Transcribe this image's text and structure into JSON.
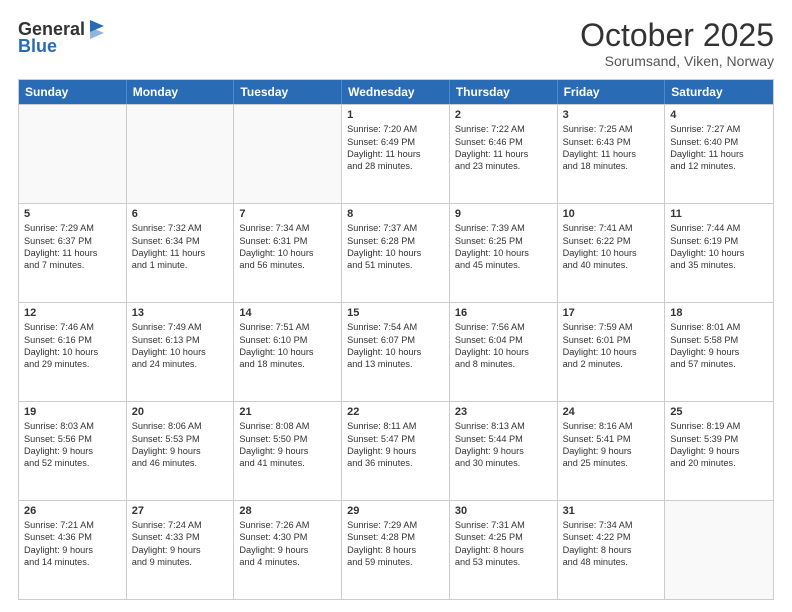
{
  "header": {
    "logo_line1": "General",
    "logo_line2": "Blue",
    "month": "October 2025",
    "location": "Sorumsand, Viken, Norway"
  },
  "weekdays": [
    "Sunday",
    "Monday",
    "Tuesday",
    "Wednesday",
    "Thursday",
    "Friday",
    "Saturday"
  ],
  "rows": [
    [
      {
        "day": "",
        "lines": []
      },
      {
        "day": "",
        "lines": []
      },
      {
        "day": "",
        "lines": []
      },
      {
        "day": "1",
        "lines": [
          "Sunrise: 7:20 AM",
          "Sunset: 6:49 PM",
          "Daylight: 11 hours",
          "and 28 minutes."
        ]
      },
      {
        "day": "2",
        "lines": [
          "Sunrise: 7:22 AM",
          "Sunset: 6:46 PM",
          "Daylight: 11 hours",
          "and 23 minutes."
        ]
      },
      {
        "day": "3",
        "lines": [
          "Sunrise: 7:25 AM",
          "Sunset: 6:43 PM",
          "Daylight: 11 hours",
          "and 18 minutes."
        ]
      },
      {
        "day": "4",
        "lines": [
          "Sunrise: 7:27 AM",
          "Sunset: 6:40 PM",
          "Daylight: 11 hours",
          "and 12 minutes."
        ]
      }
    ],
    [
      {
        "day": "5",
        "lines": [
          "Sunrise: 7:29 AM",
          "Sunset: 6:37 PM",
          "Daylight: 11 hours",
          "and 7 minutes."
        ]
      },
      {
        "day": "6",
        "lines": [
          "Sunrise: 7:32 AM",
          "Sunset: 6:34 PM",
          "Daylight: 11 hours",
          "and 1 minute."
        ]
      },
      {
        "day": "7",
        "lines": [
          "Sunrise: 7:34 AM",
          "Sunset: 6:31 PM",
          "Daylight: 10 hours",
          "and 56 minutes."
        ]
      },
      {
        "day": "8",
        "lines": [
          "Sunrise: 7:37 AM",
          "Sunset: 6:28 PM",
          "Daylight: 10 hours",
          "and 51 minutes."
        ]
      },
      {
        "day": "9",
        "lines": [
          "Sunrise: 7:39 AM",
          "Sunset: 6:25 PM",
          "Daylight: 10 hours",
          "and 45 minutes."
        ]
      },
      {
        "day": "10",
        "lines": [
          "Sunrise: 7:41 AM",
          "Sunset: 6:22 PM",
          "Daylight: 10 hours",
          "and 40 minutes."
        ]
      },
      {
        "day": "11",
        "lines": [
          "Sunrise: 7:44 AM",
          "Sunset: 6:19 PM",
          "Daylight: 10 hours",
          "and 35 minutes."
        ]
      }
    ],
    [
      {
        "day": "12",
        "lines": [
          "Sunrise: 7:46 AM",
          "Sunset: 6:16 PM",
          "Daylight: 10 hours",
          "and 29 minutes."
        ]
      },
      {
        "day": "13",
        "lines": [
          "Sunrise: 7:49 AM",
          "Sunset: 6:13 PM",
          "Daylight: 10 hours",
          "and 24 minutes."
        ]
      },
      {
        "day": "14",
        "lines": [
          "Sunrise: 7:51 AM",
          "Sunset: 6:10 PM",
          "Daylight: 10 hours",
          "and 18 minutes."
        ]
      },
      {
        "day": "15",
        "lines": [
          "Sunrise: 7:54 AM",
          "Sunset: 6:07 PM",
          "Daylight: 10 hours",
          "and 13 minutes."
        ]
      },
      {
        "day": "16",
        "lines": [
          "Sunrise: 7:56 AM",
          "Sunset: 6:04 PM",
          "Daylight: 10 hours",
          "and 8 minutes."
        ]
      },
      {
        "day": "17",
        "lines": [
          "Sunrise: 7:59 AM",
          "Sunset: 6:01 PM",
          "Daylight: 10 hours",
          "and 2 minutes."
        ]
      },
      {
        "day": "18",
        "lines": [
          "Sunrise: 8:01 AM",
          "Sunset: 5:58 PM",
          "Daylight: 9 hours",
          "and 57 minutes."
        ]
      }
    ],
    [
      {
        "day": "19",
        "lines": [
          "Sunrise: 8:03 AM",
          "Sunset: 5:56 PM",
          "Daylight: 9 hours",
          "and 52 minutes."
        ]
      },
      {
        "day": "20",
        "lines": [
          "Sunrise: 8:06 AM",
          "Sunset: 5:53 PM",
          "Daylight: 9 hours",
          "and 46 minutes."
        ]
      },
      {
        "day": "21",
        "lines": [
          "Sunrise: 8:08 AM",
          "Sunset: 5:50 PM",
          "Daylight: 9 hours",
          "and 41 minutes."
        ]
      },
      {
        "day": "22",
        "lines": [
          "Sunrise: 8:11 AM",
          "Sunset: 5:47 PM",
          "Daylight: 9 hours",
          "and 36 minutes."
        ]
      },
      {
        "day": "23",
        "lines": [
          "Sunrise: 8:13 AM",
          "Sunset: 5:44 PM",
          "Daylight: 9 hours",
          "and 30 minutes."
        ]
      },
      {
        "day": "24",
        "lines": [
          "Sunrise: 8:16 AM",
          "Sunset: 5:41 PM",
          "Daylight: 9 hours",
          "and 25 minutes."
        ]
      },
      {
        "day": "25",
        "lines": [
          "Sunrise: 8:19 AM",
          "Sunset: 5:39 PM",
          "Daylight: 9 hours",
          "and 20 minutes."
        ]
      }
    ],
    [
      {
        "day": "26",
        "lines": [
          "Sunrise: 7:21 AM",
          "Sunset: 4:36 PM",
          "Daylight: 9 hours",
          "and 14 minutes."
        ]
      },
      {
        "day": "27",
        "lines": [
          "Sunrise: 7:24 AM",
          "Sunset: 4:33 PM",
          "Daylight: 9 hours",
          "and 9 minutes."
        ]
      },
      {
        "day": "28",
        "lines": [
          "Sunrise: 7:26 AM",
          "Sunset: 4:30 PM",
          "Daylight: 9 hours",
          "and 4 minutes."
        ]
      },
      {
        "day": "29",
        "lines": [
          "Sunrise: 7:29 AM",
          "Sunset: 4:28 PM",
          "Daylight: 8 hours",
          "and 59 minutes."
        ]
      },
      {
        "day": "30",
        "lines": [
          "Sunrise: 7:31 AM",
          "Sunset: 4:25 PM",
          "Daylight: 8 hours",
          "and 53 minutes."
        ]
      },
      {
        "day": "31",
        "lines": [
          "Sunrise: 7:34 AM",
          "Sunset: 4:22 PM",
          "Daylight: 8 hours",
          "and 48 minutes."
        ]
      },
      {
        "day": "",
        "lines": []
      }
    ]
  ]
}
